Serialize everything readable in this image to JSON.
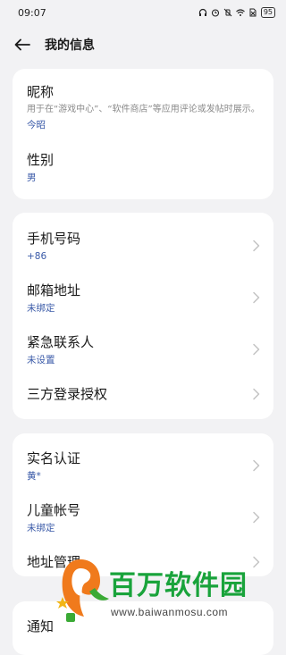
{
  "status": {
    "time": "09:07",
    "battery": "95"
  },
  "header": {
    "title": "我的信息"
  },
  "card1": {
    "nickname_label": "昵称",
    "nickname_desc": "用于在“游戏中心”、“软件商店”等应用评论或发帖时展示。",
    "nickname_value": "今昭",
    "gender_label": "性别",
    "gender_value": "男"
  },
  "card2": {
    "phone_label": "手机号码",
    "phone_value": "+86",
    "email_label": "邮箱地址",
    "email_value": "未绑定",
    "emergency_label": "紧急联系人",
    "emergency_value": "未设置",
    "thirdparty_label": "三方登录授权"
  },
  "card3": {
    "realname_label": "实名认证",
    "realname_value": "黄*",
    "child_label": "儿童帐号",
    "child_value": "未绑定",
    "address_label": "地址管理"
  },
  "card4": {
    "notify_label": "通知"
  },
  "watermark": {
    "brand": "百万软件园",
    "url": "www.baiwanmosu.com"
  },
  "colors": {
    "value_blue": "#3a5aa8",
    "background": "#f2f2f4",
    "watermark_green": "#19a33b"
  }
}
